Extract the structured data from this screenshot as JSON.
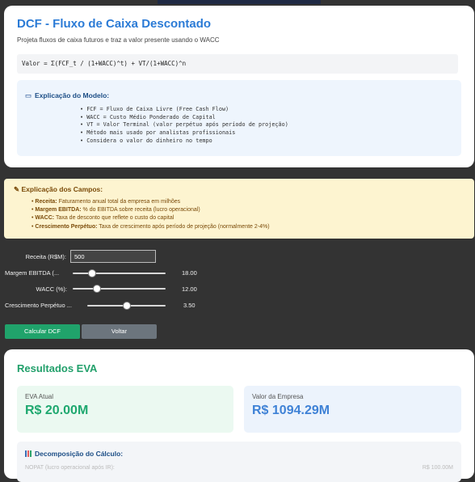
{
  "dcf": {
    "title": "DCF - Fluxo de Caixa Descontado",
    "subtitle": "Projeta fluxos de caixa futuros e traz a valor presente usando o WACC",
    "formula": "Valor = Σ(FCF_t / (1+WACC)^t) + VT/(1+WACC)^n",
    "explanation_title": "Explicação do Modelo:",
    "explanation_items": [
      "FCF = Fluxo de Caixa Livre (Free Cash Flow)",
      "WACC = Custo Médio Ponderado de Capital",
      "VT = Valor Terminal (valor perpétuo após período de projeção)",
      "Método mais usado por analistas profissionais",
      "Considera o valor do dinheiro no tempo"
    ]
  },
  "fields_help": {
    "title": "Explicação dos Campos:",
    "items": [
      {
        "term": "Receita:",
        "text": "Faturamento anual total da empresa em milhões"
      },
      {
        "term": "Margem EBITDA:",
        "text": "% do EBITDA sobre receita (lucro operacional)"
      },
      {
        "term": "WACC:",
        "text": "Taxa de desconto que reflete o custo do capital"
      },
      {
        "term": "Crescimento Perpétuo:",
        "text": "Taxa de crescimento após período de projeção (normalmente 2-4%)"
      }
    ]
  },
  "form": {
    "receita_label": "Receita (R$M):",
    "receita_value": "500",
    "margem_label": "Margem EBITDA (...",
    "margem_value": "18.00",
    "margem_level": 0.18,
    "wacc_label": "WACC (%):",
    "wacc_value": "12.00",
    "wacc_level": 0.24,
    "crescimento_label": "Crescimento Perpétuo ...",
    "crescimento_value": "3.50",
    "crescimento_level": 0.5,
    "calc_button": "Calcular DCF",
    "back_button": "Voltar"
  },
  "results": {
    "title": "Resultados EVA",
    "eva_label": "EVA Atual",
    "eva_value": "R$ 20.00M",
    "empresa_label": "Valor da Empresa",
    "empresa_value": "R$ 1094.29M",
    "decomp_title": "Decomposição do Cálculo:",
    "decomp_row_label": "NOPAT (lucro operacional após IR):",
    "decomp_row_value": "R$ 100.00M"
  }
}
